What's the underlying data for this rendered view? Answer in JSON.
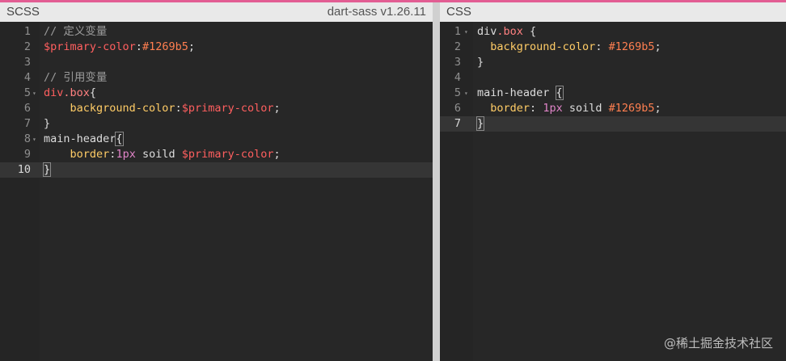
{
  "scss_pane": {
    "title": "SCSS",
    "version": "dart-sass v1.26.11",
    "lines": [
      {
        "n": "1",
        "fold": "",
        "parts": [
          {
            "t": "// 定义变量",
            "k": "c"
          }
        ]
      },
      {
        "n": "2",
        "fold": "",
        "parts": [
          {
            "t": "$primary-color",
            "k": "v"
          },
          {
            "t": ":",
            "k": "d"
          },
          {
            "t": "#1269b5",
            "k": "h"
          },
          {
            "t": ";",
            "k": "d"
          }
        ]
      },
      {
        "n": "3",
        "fold": "",
        "parts": []
      },
      {
        "n": "4",
        "fold": "",
        "parts": [
          {
            "t": "// 引用变量",
            "k": "c"
          }
        ]
      },
      {
        "n": "5",
        "fold": "▾",
        "parts": [
          {
            "t": "div",
            "k": "s"
          },
          {
            "t": ".box",
            "k": "cls"
          },
          {
            "t": "{",
            "k": "d"
          }
        ]
      },
      {
        "n": "6",
        "fold": "",
        "parts": [
          {
            "t": "    ",
            "k": "d"
          },
          {
            "t": "background-color",
            "k": "p"
          },
          {
            "t": ":",
            "k": "d"
          },
          {
            "t": "$primary-color",
            "k": "v"
          },
          {
            "t": ";",
            "k": "d"
          }
        ]
      },
      {
        "n": "7",
        "fold": "",
        "parts": [
          {
            "t": "}",
            "k": "d"
          }
        ]
      },
      {
        "n": "8",
        "fold": "▾",
        "parts": [
          {
            "t": "main-header",
            "k": "d"
          },
          {
            "t": "{",
            "k": "br"
          }
        ]
      },
      {
        "n": "9",
        "fold": "",
        "parts": [
          {
            "t": "    ",
            "k": "d"
          },
          {
            "t": "border",
            "k": "p"
          },
          {
            "t": ":",
            "k": "d"
          },
          {
            "t": "1px",
            "k": "u"
          },
          {
            "t": " soild ",
            "k": "d"
          },
          {
            "t": "$primary-color",
            "k": "v"
          },
          {
            "t": ";",
            "k": "d"
          }
        ]
      },
      {
        "n": "10",
        "fold": "",
        "active": true,
        "parts": [
          {
            "t": "}",
            "k": "br"
          }
        ]
      }
    ]
  },
  "css_pane": {
    "title": "CSS",
    "lines": [
      {
        "n": "1",
        "fold": "▾",
        "parts": [
          {
            "t": "div",
            "k": "d"
          },
          {
            "t": ".box",
            "k": "cls"
          },
          {
            "t": " {",
            "k": "d"
          }
        ]
      },
      {
        "n": "2",
        "fold": "",
        "parts": [
          {
            "t": "  ",
            "k": "d"
          },
          {
            "t": "background-color",
            "k": "p"
          },
          {
            "t": ": ",
            "k": "d"
          },
          {
            "t": "#1269b5",
            "k": "h"
          },
          {
            "t": ";",
            "k": "d"
          }
        ]
      },
      {
        "n": "3",
        "fold": "",
        "parts": [
          {
            "t": "}",
            "k": "d"
          }
        ]
      },
      {
        "n": "4",
        "fold": "",
        "parts": []
      },
      {
        "n": "5",
        "fold": "▾",
        "parts": [
          {
            "t": "main-header ",
            "k": "d"
          },
          {
            "t": "{",
            "k": "br"
          }
        ]
      },
      {
        "n": "6",
        "fold": "",
        "parts": [
          {
            "t": "  ",
            "k": "d"
          },
          {
            "t": "border",
            "k": "p"
          },
          {
            "t": ": ",
            "k": "d"
          },
          {
            "t": "1px",
            "k": "u"
          },
          {
            "t": " soild ",
            "k": "d"
          },
          {
            "t": "#1269b5",
            "k": "h"
          },
          {
            "t": ";",
            "k": "d"
          }
        ]
      },
      {
        "n": "7",
        "fold": "",
        "active": true,
        "parts": [
          {
            "t": "}",
            "k": "br"
          }
        ]
      }
    ]
  },
  "watermark": "@稀土掘金技术社区",
  "colors": {
    "accent_bar": "#e25d93",
    "hex_value": "#ff7f50",
    "property": "#ffcc66"
  }
}
